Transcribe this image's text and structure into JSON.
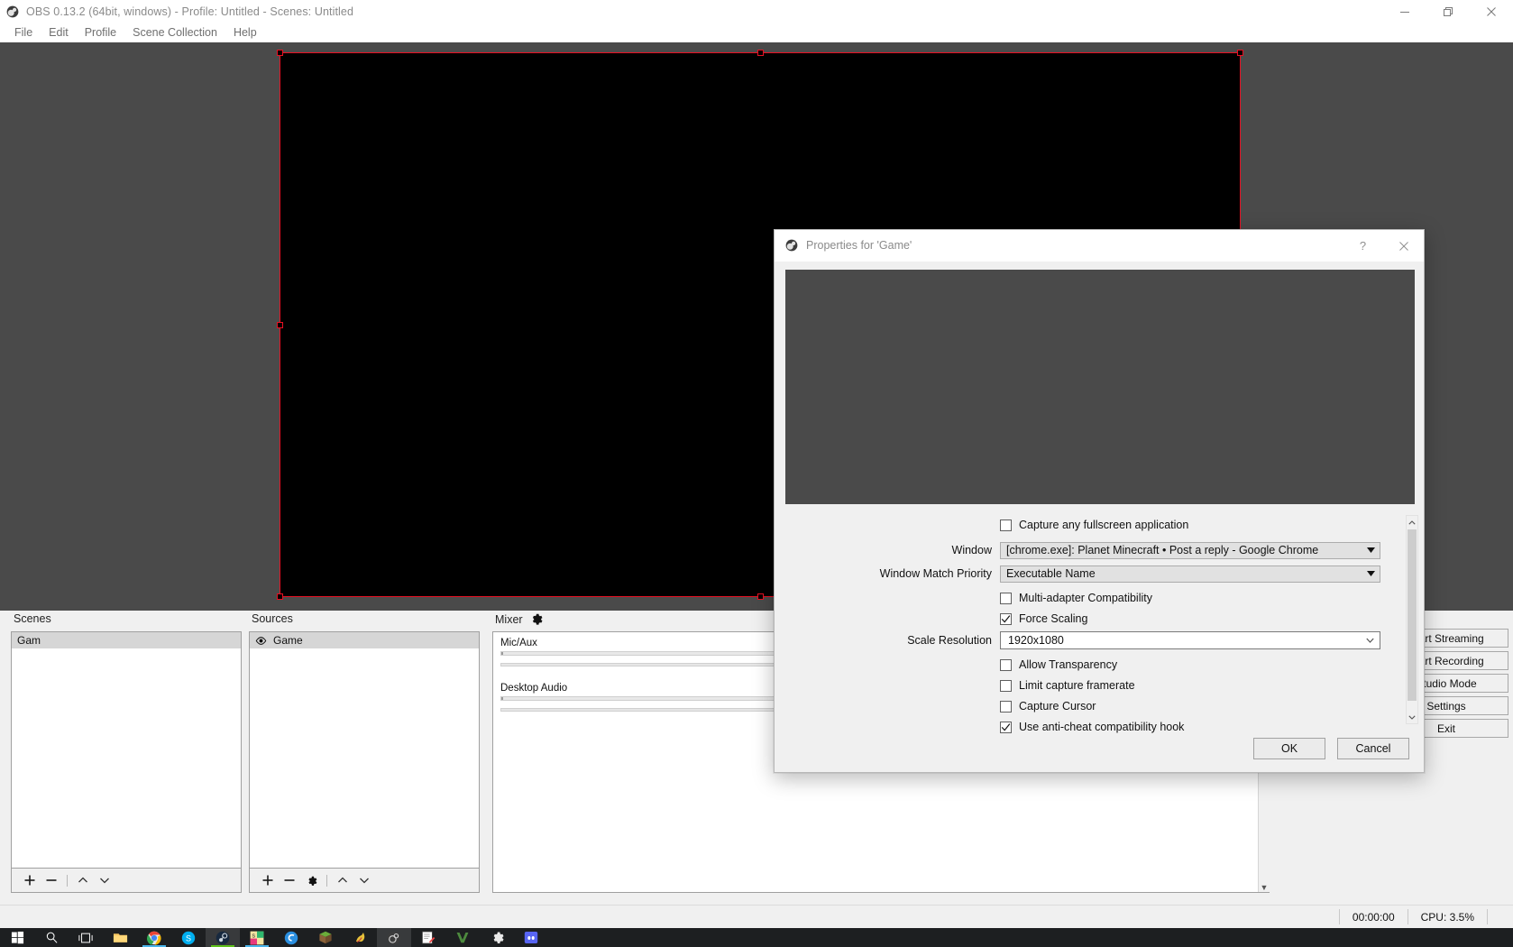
{
  "window": {
    "title": "OBS 0.13.2 (64bit, windows) - Profile: Untitled - Scenes: Untitled",
    "icon": "obs-logo-icon",
    "minimize": "minimize-icon",
    "maximize": "restore-icon",
    "close": "close-icon"
  },
  "menubar": {
    "items": [
      {
        "label": "File"
      },
      {
        "label": "Edit"
      },
      {
        "label": "Profile"
      },
      {
        "label": "Scene Collection"
      },
      {
        "label": "Help"
      }
    ]
  },
  "preview": {
    "selection_color": "#e81123",
    "canvas_color": "#000000",
    "background_color": "#4a4a4a"
  },
  "docks": {
    "scenes": {
      "title": "Scenes",
      "items": [
        {
          "label": "Gam",
          "selected": true
        }
      ],
      "toolbar": [
        {
          "icon": "plus-icon",
          "label": "+"
        },
        {
          "icon": "minus-icon",
          "label": "−"
        },
        {
          "icon": "chevron-up-icon",
          "label": "∧"
        },
        {
          "icon": "chevron-down-icon",
          "label": "∨"
        }
      ]
    },
    "sources": {
      "title": "Sources",
      "items": [
        {
          "label": "Game",
          "visible_icon": "eye-icon",
          "selected": true
        }
      ],
      "toolbar": [
        {
          "icon": "plus-icon",
          "label": "+"
        },
        {
          "icon": "minus-icon",
          "label": "−"
        },
        {
          "icon": "gear-icon",
          "label": "⚙"
        },
        {
          "icon": "chevron-up-icon",
          "label": "∧"
        },
        {
          "icon": "chevron-down-icon",
          "label": "∨"
        }
      ]
    },
    "mixer": {
      "title": "Mixer",
      "settings_icon": "gear-icon",
      "tracks": [
        {
          "name": "Mic/Aux"
        },
        {
          "name": "Desktop Audio"
        }
      ]
    },
    "controls": {
      "buttons": [
        {
          "label": "Start Streaming"
        },
        {
          "label": "Start Recording"
        },
        {
          "label": "Studio Mode"
        },
        {
          "label": "Settings"
        },
        {
          "label": "Exit"
        }
      ]
    }
  },
  "statusbar": {
    "timer": "00:00:00",
    "cpu": "CPU: 3.5%"
  },
  "taskbar": {
    "items": [
      {
        "name": "start-button",
        "icon": "windows-logo-icon"
      },
      {
        "name": "search-button",
        "icon": "search-icon"
      },
      {
        "name": "task-view-button",
        "icon": "task-view-icon"
      },
      {
        "name": "file-explorer",
        "icon": "folder-icon"
      },
      {
        "name": "google-chrome",
        "icon": "chrome-icon"
      },
      {
        "name": "skype",
        "icon": "skype-icon"
      },
      {
        "name": "steam",
        "icon": "steam-icon"
      },
      {
        "name": "snipping-app",
        "icon": "s-app-icon"
      },
      {
        "name": "blue-app",
        "icon": "swirl-icon"
      },
      {
        "name": "minecraft",
        "icon": "grass-block-icon"
      },
      {
        "name": "bird-app",
        "icon": "bird-icon"
      },
      {
        "name": "obs-studio",
        "icon": "obs-logo-icon"
      },
      {
        "name": "notepad-editor",
        "icon": "notepad-icon"
      },
      {
        "name": "v-app",
        "icon": "v-icon"
      },
      {
        "name": "settings",
        "icon": "gear-icon"
      },
      {
        "name": "discord",
        "icon": "discord-icon"
      }
    ]
  },
  "dialog": {
    "title": "Properties for 'Game'",
    "icon": "obs-logo-icon",
    "help_icon": "question-mark-icon",
    "close_icon": "close-icon",
    "fields": {
      "capture_fullscreen": {
        "label": "Capture any fullscreen application",
        "checked": false
      },
      "window": {
        "label": "Window",
        "value": "[chrome.exe]: Planet Minecraft • Post a reply - Google Chrome"
      },
      "window_match_priority": {
        "label": "Window Match Priority",
        "value": "Executable Name"
      },
      "multi_adapter": {
        "label": "Multi-adapter Compatibility",
        "checked": false
      },
      "force_scaling": {
        "label": "Force Scaling",
        "checked": true
      },
      "scale_resolution": {
        "label": "Scale Resolution",
        "value": "1920x1080"
      },
      "allow_transparency": {
        "label": "Allow Transparency",
        "checked": false
      },
      "limit_framerate": {
        "label": "Limit capture framerate",
        "checked": false
      },
      "capture_cursor": {
        "label": "Capture Cursor",
        "checked": false
      },
      "anti_cheat_hook": {
        "label": "Use anti-cheat compatibility hook",
        "checked": true
      }
    },
    "buttons": {
      "ok": "OK",
      "cancel": "Cancel"
    }
  }
}
